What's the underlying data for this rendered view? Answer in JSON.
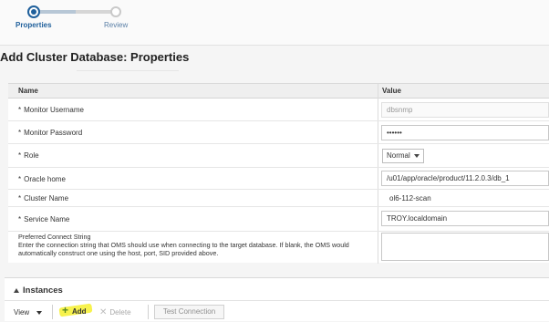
{
  "train": {
    "steps": [
      {
        "label": "Properties",
        "state": "current"
      },
      {
        "label": "Review",
        "state": "next"
      }
    ]
  },
  "page": {
    "title": "Add Cluster Database: Properties"
  },
  "table": {
    "headers": {
      "name": "Name",
      "value": "Value"
    },
    "rows": [
      {
        "label": "Monitor Username",
        "required": "*",
        "value": "dbsnmp",
        "kind": "readonly"
      },
      {
        "label": "Monitor Password",
        "required": "*",
        "value": "••••••",
        "kind": "password"
      },
      {
        "label": "Role",
        "required": "*",
        "value": "Normal",
        "kind": "select"
      },
      {
        "label": "Oracle home",
        "required": "*",
        "value": "/u01/app/oracle/product/11.2.0.3/db_1",
        "kind": "text"
      },
      {
        "label": "Cluster Name",
        "required": "*",
        "value": "ol6-112-scan",
        "kind": "plain"
      },
      {
        "label": "Service Name",
        "required": "*",
        "value": "TROY.localdomain",
        "kind": "text"
      }
    ],
    "connect_string": {
      "label": "Preferred Connect String",
      "description": "Enter the connection string that OMS should use when connecting to the target database. If blank, the OMS would automatically construct one using the host, port, SID provided above.",
      "value": ""
    }
  },
  "instances": {
    "title": "Instances",
    "toolbar": {
      "view": "View",
      "add": "Add",
      "delete": "Delete",
      "test": "Test Connection"
    }
  },
  "colors": {
    "accent": "#1f5f9b",
    "highlight": "#f6f13a",
    "add_icon": "#5a8a24"
  }
}
